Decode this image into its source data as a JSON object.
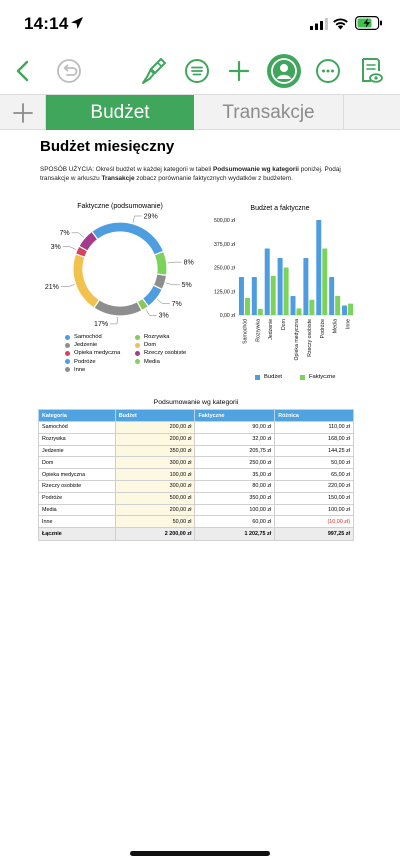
{
  "status": {
    "time": "14:14"
  },
  "tabs": {
    "active": "Budżet",
    "inactive": "Transakcje"
  },
  "sheet": {
    "title": "Budżet miesięczny",
    "instr_a": "SPOSÓB UŻYCIA: Określ budżet w każdej kategorii w tabeli ",
    "instr_b": "Podsumowanie wg kategorii",
    "instr_c": " poniżej. Podaj transakcje w arkuszu ",
    "instr_d": "Transakcje",
    "instr_e": " zobacz porównanie faktycznych wydatków z budżetem."
  },
  "chart_data": [
    {
      "type": "pie",
      "title": "Faktyczne (podsumowanie)",
      "categories": [
        "Samochód",
        "Rozrywka",
        "Jedzenie",
        "Dom",
        "Opieka medyczna",
        "Rzeczy osobiste",
        "Podróże",
        "Media",
        "Inne"
      ],
      "values": [
        90,
        32,
        205.75,
        250,
        35,
        80,
        350,
        100,
        60
      ],
      "slice_labels": [
        "7%",
        "3%",
        "17%",
        "21%",
        "3%",
        "7%",
        "29%",
        "8%",
        "5%"
      ],
      "colors": [
        "#4d9de0",
        "#88c957",
        "#8e8e8e",
        "#f2c14e",
        "#d6425f",
        "#a43c8c",
        "#4d9de0",
        "#7cd35b",
        "#8e8e8e"
      ],
      "legend": [
        {
          "label": "Samochód",
          "color": "#4d9de0"
        },
        {
          "label": "Rozrywka",
          "color": "#88c957"
        },
        {
          "label": "Jedzenie",
          "color": "#8e8e8e"
        },
        {
          "label": "Dom",
          "color": "#f2c14e"
        },
        {
          "label": "Opieka medyczna",
          "color": "#d6425f"
        },
        {
          "label": "Rzeczy osobiste",
          "color": "#a43c8c"
        },
        {
          "label": "Podróże",
          "color": "#4d9de0"
        },
        {
          "label": "Media",
          "color": "#7cd35b"
        },
        {
          "label": "Inne",
          "color": "#8e8e8e"
        }
      ]
    },
    {
      "type": "bar",
      "title": "Budżet a faktyczne",
      "categories": [
        "Samochód",
        "Rozrywka",
        "Jedzenie",
        "Dom",
        "Opieka medyczna",
        "Rzeczy osobiste",
        "Podróże",
        "Media",
        "Inne"
      ],
      "series": [
        {
          "name": "Budżet",
          "color": "#4d9de0",
          "values": [
            200,
            200,
            350,
            300,
            100,
            300,
            500,
            200,
            50
          ]
        },
        {
          "name": "Faktyczne",
          "color": "#7cd35b",
          "values": [
            90,
            32,
            205.75,
            250,
            35,
            80,
            350,
            100,
            60
          ]
        }
      ],
      "ylim": [
        0,
        500
      ],
      "yticks": [
        "0,00 zł",
        "125,00 zł",
        "250,00 zł",
        "375,00 zł",
        "500,00 zł"
      ],
      "grid": false,
      "legend_position": "bottom"
    }
  ],
  "table": {
    "title": "Podsumowanie wg kategorii",
    "headers": [
      "Kategoria",
      "Budżet",
      "Faktyczne",
      "Różnica"
    ],
    "rows": [
      [
        "Samochód",
        "200,00 zł",
        "90,00 zł",
        "110,00 zł"
      ],
      [
        "Rozrywka",
        "200,00 zł",
        "32,00 zł",
        "168,00 zł"
      ],
      [
        "Jedzenie",
        "350,00 zł",
        "205,75 zł",
        "144,25 zł"
      ],
      [
        "Dom",
        "300,00 zł",
        "250,00 zł",
        "50,00 zł"
      ],
      [
        "Opieka medyczna",
        "100,00 zł",
        "35,00 zł",
        "65,00 zł"
      ],
      [
        "Rzeczy osobiste",
        "300,00 zł",
        "80,00 zł",
        "220,00 zł"
      ],
      [
        "Podróże",
        "500,00 zł",
        "350,00 zł",
        "150,00 zł"
      ],
      [
        "Media",
        "200,00 zł",
        "100,00 zł",
        "100,00 zł"
      ],
      [
        "Inne",
        "50,00 zł",
        "60,00 zł",
        "(10,00 zł)"
      ]
    ],
    "total": [
      "Łącznie",
      "2 200,00 zł",
      "1 202,75 zł",
      "997,25 zł"
    ]
  },
  "colors": {
    "accent": "#3fa65c",
    "header_blue": "#4fa3e0",
    "negative": "#d1342b"
  }
}
